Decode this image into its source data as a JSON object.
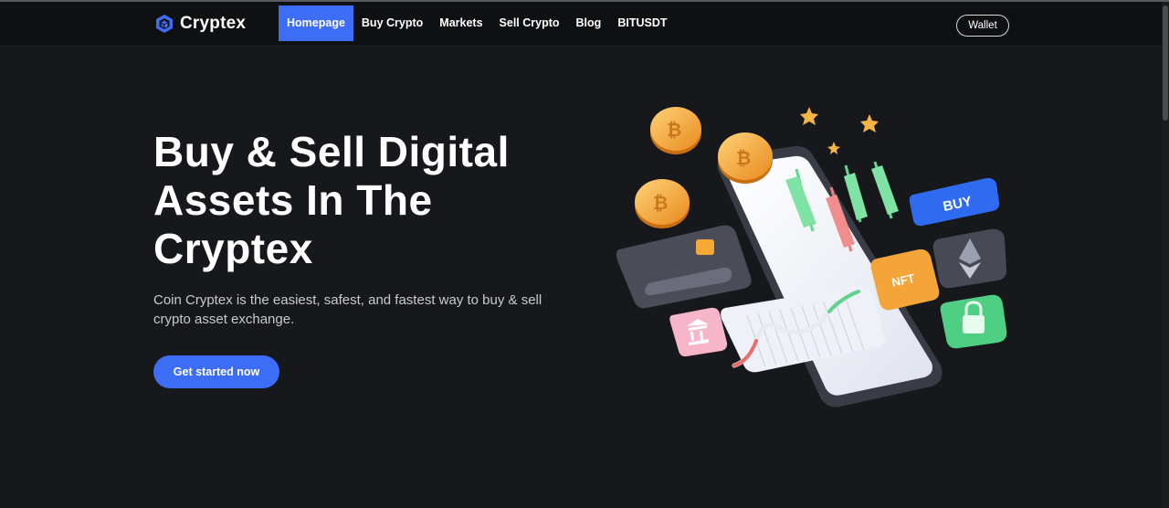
{
  "brand": {
    "name": "Cryptex",
    "icon": "cube-logo-icon"
  },
  "nav": {
    "items": [
      {
        "label": "Homepage",
        "active": true
      },
      {
        "label": "Buy Crypto",
        "active": false
      },
      {
        "label": "Markets",
        "active": false
      },
      {
        "label": "Sell Crypto",
        "active": false
      },
      {
        "label": "Blog",
        "active": false
      },
      {
        "label": "BITUSDT",
        "active": false
      }
    ],
    "wallet_label": "Wallet"
  },
  "hero": {
    "title_lines": [
      "Buy & Sell Digital",
      "Assets In The",
      "Cryptex"
    ],
    "description": "Coin Cryptex is the easiest, safest, and fastest way to buy & sell crypto asset exchange.",
    "cta_label": "Get started now"
  },
  "illustration": {
    "buy_tag": "BUY",
    "nft_tag": "NFT",
    "icons": [
      "bitcoin-coin-icon",
      "star-icon",
      "ethereum-icon",
      "lock-icon",
      "bank-icon",
      "credit-card-icon",
      "candlestick-chart-icon",
      "smartphone-icon"
    ]
  },
  "colors": {
    "background": "#17181c",
    "navbar": "#0f1012",
    "accent": "#3d6cf5",
    "text_muted": "#c9c9cf"
  }
}
